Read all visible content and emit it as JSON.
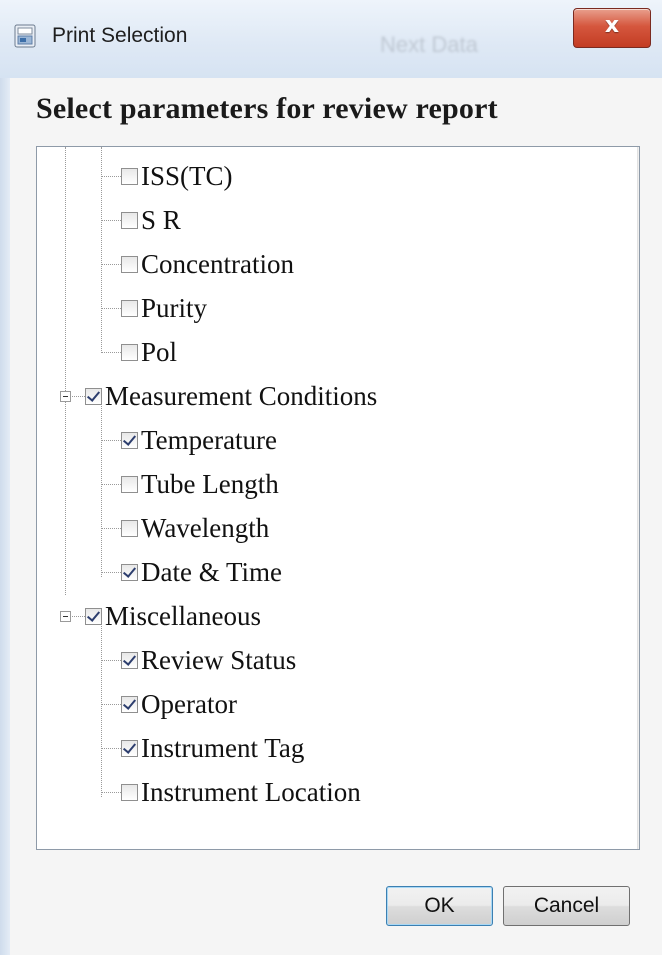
{
  "window": {
    "title": "Print Selection",
    "close_label": "x",
    "background_ghost_text": "Next Data"
  },
  "dialog": {
    "heading": "Select parameters for review report"
  },
  "tree": {
    "items": [
      {
        "label": "ISS(TC)",
        "checked": false
      },
      {
        "label": "S R",
        "checked": false
      },
      {
        "label": "Concentration",
        "checked": false
      },
      {
        "label": "Purity",
        "checked": false
      },
      {
        "label": "Pol",
        "checked": false
      },
      {
        "label": "Measurement Conditions",
        "checked": true
      },
      {
        "label": "Temperature",
        "checked": true
      },
      {
        "label": "Tube Length",
        "checked": false
      },
      {
        "label": "Wavelength",
        "checked": false
      },
      {
        "label": "Date & Time",
        "checked": true
      },
      {
        "label": "Miscellaneous",
        "checked": true
      },
      {
        "label": "Review Status",
        "checked": true
      },
      {
        "label": "Operator",
        "checked": true
      },
      {
        "label": "Instrument Tag",
        "checked": true
      },
      {
        "label": "Instrument Location",
        "checked": false
      }
    ]
  },
  "scrollbar": {
    "up_icon": "▲",
    "down_icon": "▼"
  },
  "buttons": {
    "ok": "OK",
    "cancel": "Cancel"
  },
  "colors": {
    "close_button": "#c33c23",
    "check_mark": "#2d3e6e"
  }
}
